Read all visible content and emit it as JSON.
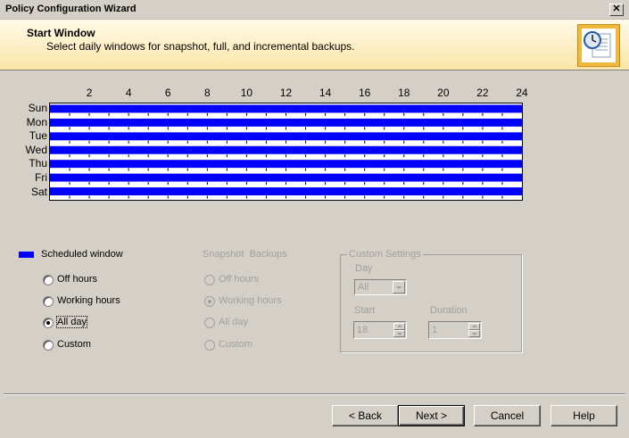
{
  "window": {
    "title": "Policy Configuration Wizard",
    "close_glyph": "✕"
  },
  "header": {
    "title": "Start Window",
    "subtitle": "Select daily windows for snapshot, full, and incremental backups.",
    "icon": "wizard-clock-document-icon"
  },
  "schedule": {
    "hour_labels": [
      "2",
      "4",
      "6",
      "8",
      "10",
      "12",
      "14",
      "16",
      "18",
      "20",
      "22",
      "24"
    ],
    "days": [
      "Sun",
      "Mon",
      "Tue",
      "Wed",
      "Thu",
      "Fri",
      "Sat"
    ],
    "scheduled_fraction_per_day": [
      1,
      1,
      1,
      1,
      1,
      1,
      1
    ],
    "window_color": "#0000ff"
  },
  "legend": {
    "label": "Scheduled window",
    "color": "#0000ff"
  },
  "window_options": {
    "items": [
      {
        "label": "Off hours",
        "checked": false
      },
      {
        "label": "Working hours",
        "checked": false
      },
      {
        "label": "All day",
        "checked": true
      },
      {
        "label": "Custom",
        "checked": false
      }
    ]
  },
  "snapshot_backups": {
    "title": "Snapshot  Backups",
    "items": [
      {
        "label": "Off hours",
        "checked": false
      },
      {
        "label": "Working hours",
        "checked": true
      },
      {
        "label": "All day",
        "checked": false
      },
      {
        "label": "Custom",
        "checked": false
      }
    ]
  },
  "custom_settings": {
    "title": "Custom Settings",
    "day_label": "Day",
    "day_value": "All",
    "start_label": "Start",
    "start_value": "18",
    "duration_label": "Duration",
    "duration_value": "1"
  },
  "buttons": {
    "back": "< Back",
    "next": "Next >",
    "cancel": "Cancel",
    "help": "Help"
  }
}
